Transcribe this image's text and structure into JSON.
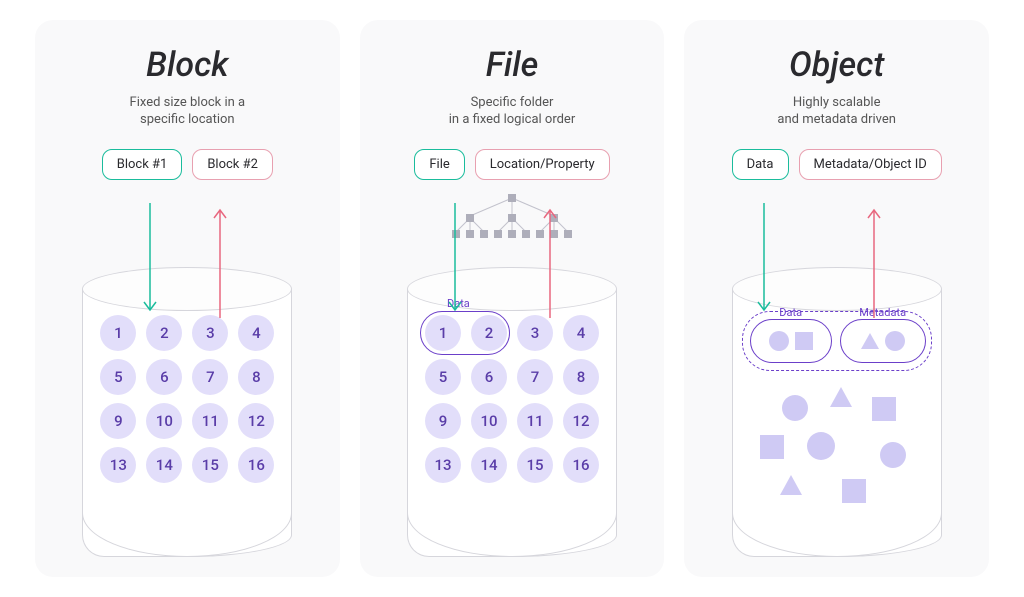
{
  "panels": {
    "block": {
      "title": "Block",
      "subtitle": "Fixed size block in a\nspecific location",
      "tag_left": "Block #1",
      "tag_right": "Block #2",
      "cells": [
        "1",
        "2",
        "3",
        "4",
        "5",
        "6",
        "7",
        "8",
        "9",
        "10",
        "11",
        "12",
        "13",
        "14",
        "15",
        "16"
      ]
    },
    "file": {
      "title": "File",
      "subtitle": "Specific folder\nin a fixed logical order",
      "tag_left": "File",
      "tag_right": "Location/Property",
      "data_label": "Data",
      "cells": [
        "1",
        "2",
        "3",
        "4",
        "5",
        "6",
        "7",
        "8",
        "9",
        "10",
        "11",
        "12",
        "13",
        "14",
        "15",
        "16"
      ]
    },
    "object": {
      "title": "Object",
      "subtitle": "Highly scalable\nand metadata driven",
      "tag_left": "Data",
      "tag_right": "Metadata/Object ID",
      "cap_left_label": "Data",
      "cap_right_label": "Metadata"
    }
  },
  "colors": {
    "teal": "#1abc9c",
    "pink": "#e8677f",
    "purple": "#6b3fc9",
    "lilac": "#e2defa"
  }
}
